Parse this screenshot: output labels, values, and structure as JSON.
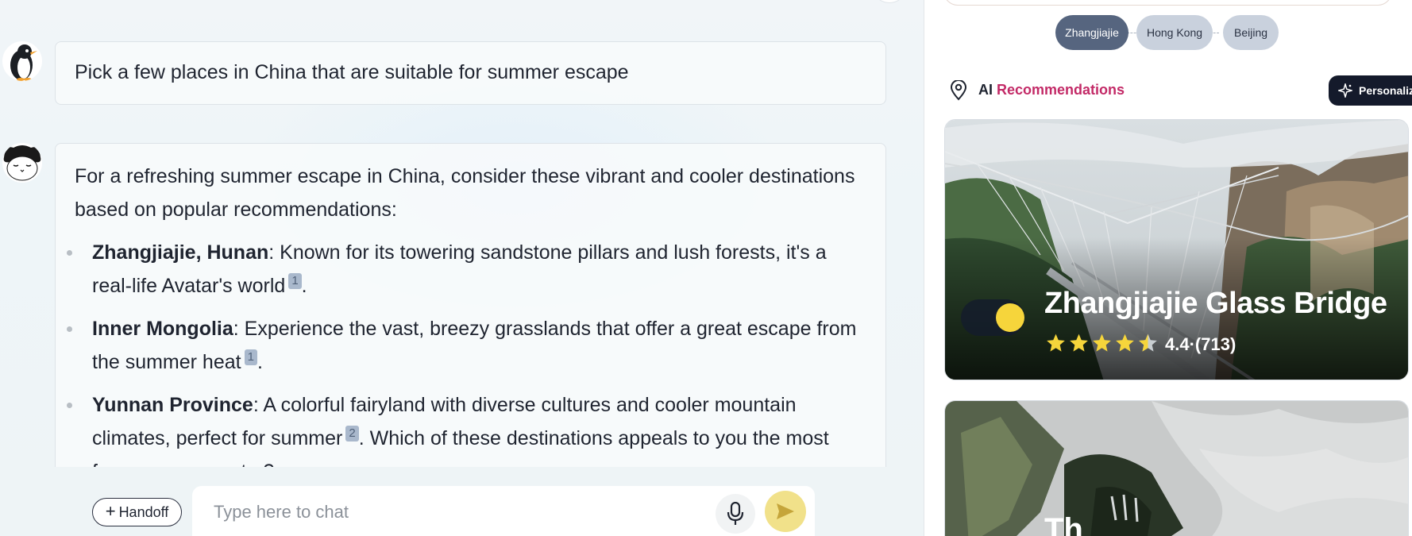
{
  "chat": {
    "user_message": "Pick a few places in China that are suitable for summer escape",
    "bot_intro": "For a refreshing summer escape in China, consider these vibrant and cooler destinations based on popular recommendations:",
    "bot_items": [
      {
        "title": "Zhangjiajie, Hunan",
        "text": ": Known for its towering sandstone pillars and lush forests, it's a real-life Avatar's world",
        "cite": "1",
        "tail": "."
      },
      {
        "title": "Inner Mongolia",
        "text": ": Experience the vast, breezy grasslands that offer a great escape from the summer heat",
        "cite": "1",
        "tail": "."
      },
      {
        "title": "Yunnan Province",
        "text": ": A colorful fairyland with diverse cultures and cooler mountain climates, perfect for summer",
        "cite": "2",
        "tail": ". Which of these destinations appeals to you the most"
      }
    ],
    "bot_cut_line": "f                          t   ?",
    "handoff_label": "Handoff",
    "input_placeholder": "Type here to chat",
    "icons": {
      "mic": "microphone-icon",
      "send": "send-icon",
      "plus": "plus-icon"
    }
  },
  "itinerary": {
    "steps": [
      {
        "label": "Zhangjiajie",
        "active": true
      },
      {
        "label": "Hong Kong",
        "active": false
      },
      {
        "label": "Beijing",
        "active": false
      }
    ]
  },
  "recommendations": {
    "title_prefix": "AI ",
    "title_accent": "Recommendations",
    "personalize_label": "Personalize",
    "accent_color": "#c32a67",
    "cards": [
      {
        "name": "Zhangjiajie Glass Bridge",
        "rating_text": "4.4·(713)",
        "stars": 4.4
      },
      {
        "name": "Th"
      }
    ]
  },
  "colors": {
    "step_active": "#56657f",
    "step_idle": "#c9d1dd",
    "send_button": "#f1e18a",
    "personalize_bg": "#141a2b",
    "star": "#f6d53b"
  }
}
